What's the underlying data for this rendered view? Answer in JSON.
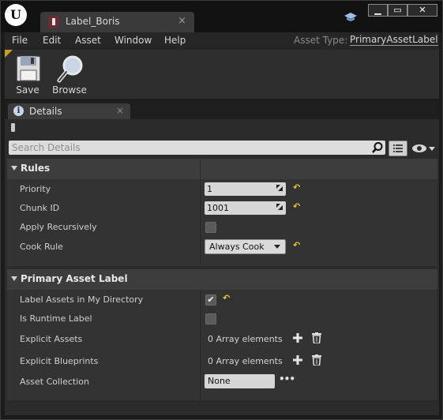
{
  "window": {
    "tab_title": "Label_Boris",
    "tab_close": "×",
    "min_glyph": "▁",
    "max_glyph": "▭",
    "close_glyph": "✕"
  },
  "menubar": {
    "items": [
      "File",
      "Edit",
      "Asset",
      "Window",
      "Help"
    ],
    "asset_type_label": "Asset Type:",
    "asset_type_value": "PrimaryAssetLabel"
  },
  "toolbar": {
    "save_label": "Save",
    "browse_label": "Browse"
  },
  "details": {
    "tab_label": "Details",
    "tab_close": "×",
    "search_placeholder": "Search Details"
  },
  "categories": {
    "rules": {
      "title": "Rules",
      "priority_label": "Priority",
      "priority_value": "1",
      "chunk_id_label": "Chunk ID",
      "chunk_id_value": "1001",
      "apply_recursively_label": "Apply Recursively",
      "apply_recursively_checked": false,
      "cook_rule_label": "Cook Rule",
      "cook_rule_value": "Always Cook"
    },
    "primary_asset_label": {
      "title": "Primary Asset Label",
      "label_assets_label": "Label Assets in My Directory",
      "label_assets_checked": true,
      "is_runtime_label": "Is Runtime Label",
      "is_runtime_checked": false,
      "explicit_assets_label": "Explicit Assets",
      "explicit_assets_value": "0 Array elements",
      "explicit_blueprints_label": "Explicit Blueprints",
      "explicit_blueprints_value": "0 Array elements",
      "asset_collection_label": "Asset Collection",
      "asset_collection_value": "None",
      "more_glyph": "•••"
    }
  },
  "colors": {
    "reset_arrow": "#e6c830",
    "panel_bg": "#2b2b2b",
    "category_bg": "#3d3d3d"
  },
  "icons": [
    "unreal-logo-icon",
    "asset-label-icon",
    "graduation-cap-icon",
    "save-icon",
    "browse-magnifier-icon",
    "info-icon",
    "lock-icon",
    "search-icon",
    "view-options-icon",
    "eye-icon",
    "reset-to-default-icon",
    "add-icon",
    "trash-icon"
  ]
}
